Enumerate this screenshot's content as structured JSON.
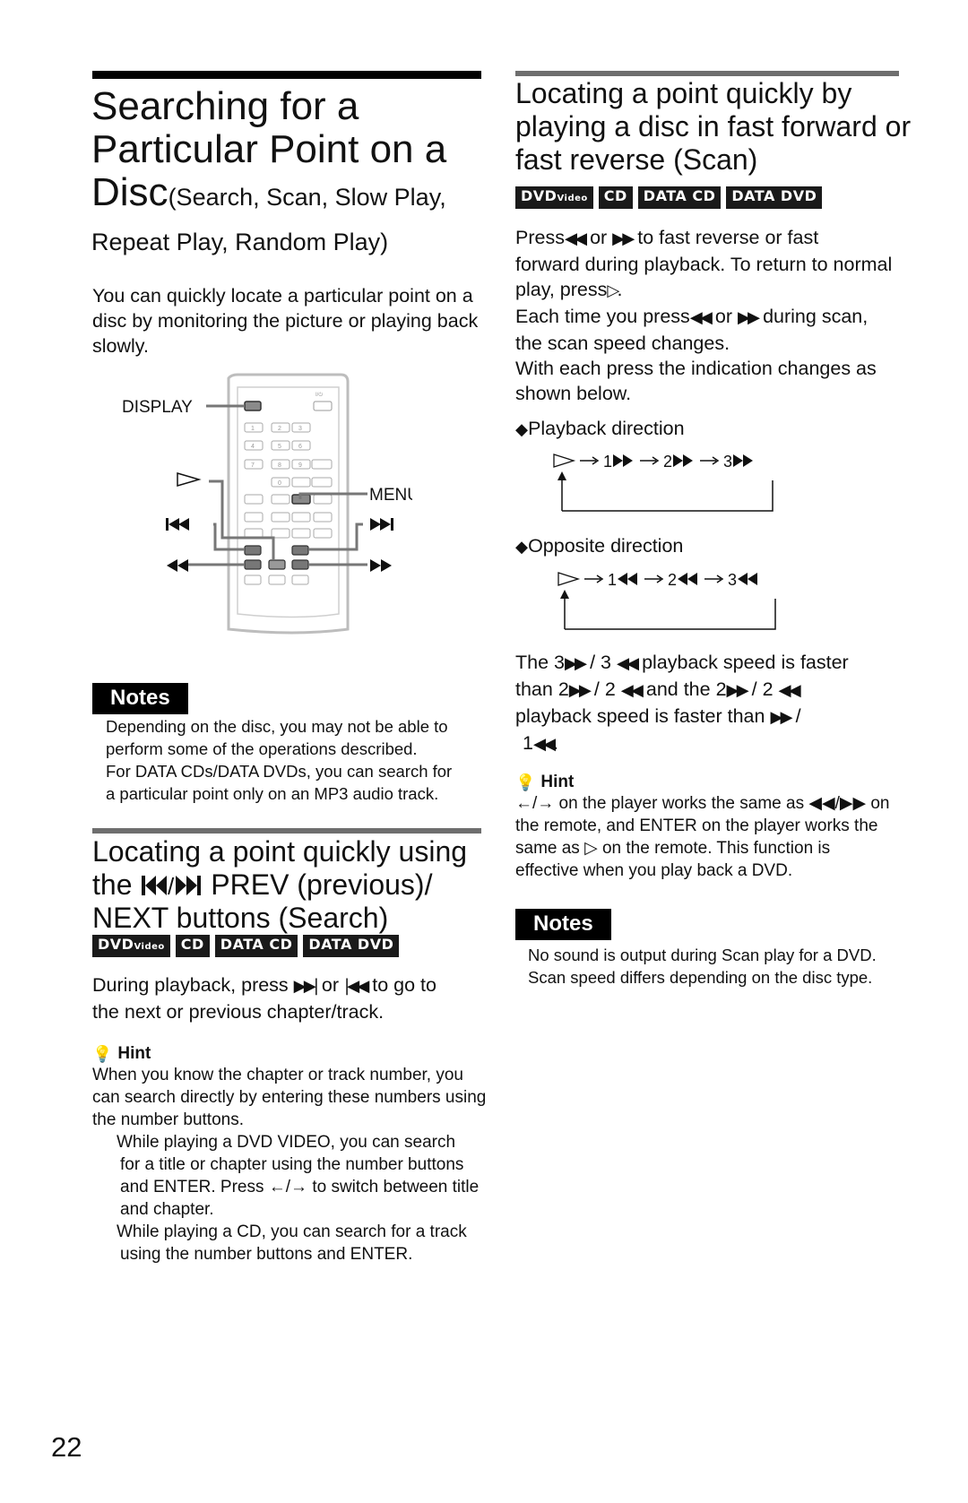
{
  "left": {
    "title_line1": "Searching for a",
    "title_line2": "Particular Point on a",
    "title_line3_big": "Disc",
    "title_line3_small": "(Search, Scan, Slow Play,",
    "title_line4": "Repeat Play, Random Play)",
    "intro": [
      "You can quickly locate a particular point on a",
      "disc by monitoring the picture or playing back",
      "slowly."
    ],
    "remote": {
      "labels": {
        "display": "DISPLAY",
        "menu": "MENU",
        "play_icon": "play-icon",
        "prev_icon": "prev-icon",
        "next_icon": "next-icon",
        "rewind_icon": "rewind-icon",
        "ffwd_icon": "fast-forward-icon"
      },
      "number_keys": [
        "1",
        "2",
        "3",
        "4",
        "5",
        "6",
        "7",
        "8",
        "9",
        "0"
      ],
      "power_label": "I/⏻"
    },
    "notes": {
      "label": "Notes",
      "items": [
        [
          "Depending on the disc, you may not be able to",
          "perform some of the operations described."
        ],
        [
          "For DATA CDs/DATA DVDs, you can search for",
          "a particular point only on an MP3 audio track."
        ]
      ]
    },
    "section2": {
      "title_line1": "Locating a point quickly using",
      "title_line2_pre": "the",
      "title_line2_post": "PREV (previous)/",
      "title_line3": "NEXT buttons (Search)",
      "badges": [
        "DVD",
        "CD",
        "DATA CD",
        "DATA DVD"
      ],
      "badge_dvd_sub": "Video",
      "body_line1_a": "During playback, press",
      "body_line1_b": "or",
      "body_line1_c": "to go to",
      "body_line2": "the next or previous chapter/track.",
      "hint": {
        "label": "Hint",
        "lines": [
          "When you know the chapter or track number, you",
          "can search directly by entering these numbers using",
          "the number buttons."
        ],
        "bullet1": [
          "While playing a DVD VIDEO, you can search",
          "for a title or chapter using the number buttons",
          "and ENTER. Press ←/→ to switch between title",
          "and chapter."
        ],
        "bullet2": [
          "While playing a CD, you can search for a track",
          "using the number buttons and ENTER."
        ]
      }
    }
  },
  "right": {
    "title_lines": [
      "Locating a point quickly by",
      "playing a disc in fast forward or",
      "fast reverse (Scan)"
    ],
    "badges": [
      "DVD",
      "CD",
      "DATA CD",
      "DATA DVD"
    ],
    "badge_dvd_sub": "Video",
    "body": {
      "l1_a": "Press",
      "l1_b": "or",
      "l1_c": "to fast reverse or fast",
      "l2": "forward during playback. To return to normal",
      "l3_a": "play, press",
      "l3_b": ".",
      "l4_a": "Each time you press",
      "l4_b": "or",
      "l4_c": "during scan,",
      "l5": "the scan speed changes.",
      "l6": "With each press the indication changes as",
      "l7": "shown below."
    },
    "playback_direction": {
      "label": "Playback direction",
      "steps": [
        "1",
        "2",
        "3"
      ]
    },
    "opposite_direction": {
      "label": "Opposite direction",
      "steps": [
        "1",
        "2",
        "3"
      ]
    },
    "speed_text": {
      "l1_a": "The 3",
      "l1_b": "/ 3",
      "l1_c": "playback speed is faster",
      "l2_a": "than 2",
      "l2_b": "/ 2",
      "l2_c": "and the 2",
      "l2_d": "/ 2",
      "l3_a": "playback speed is faster than",
      "l3_b": "/",
      "l4_a": "1",
      "l4_b": "."
    },
    "hint": {
      "label": "Hint",
      "lines": [
        "←/→ on the player works the same as ◀◀/▶▶ on",
        "the remote, and ENTER on the player works the",
        "same as ▷ on the remote. This function is",
        "effective when you play back a DVD."
      ]
    },
    "notes": {
      "label": "Notes",
      "items": [
        "No sound is output during Scan play for a DVD.",
        "Scan speed differs depending on the disc type."
      ]
    }
  },
  "page_number": "22"
}
